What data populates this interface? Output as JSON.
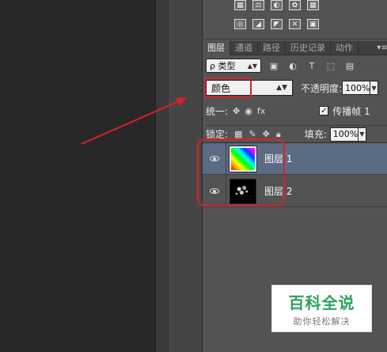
{
  "tabs": [
    {
      "label": "图层",
      "active": true
    },
    {
      "label": "通道",
      "active": false
    },
    {
      "label": "路径",
      "active": false
    },
    {
      "label": "历史记录",
      "active": false
    },
    {
      "label": "动作",
      "active": false
    }
  ],
  "filter": {
    "kind_label": "ρ 类型"
  },
  "blend": {
    "mode": "颜色",
    "opacity_label": "不透明度:",
    "opacity_value": "100%"
  },
  "unify": {
    "label": "统一:",
    "propagate_label": "传播帧 1"
  },
  "lock": {
    "label": "锁定:",
    "fill_label": "填充:",
    "fill_value": "100%"
  },
  "layers": [
    {
      "name": "图层 1",
      "selected": true
    },
    {
      "name": "图层 2",
      "selected": false
    }
  ],
  "watermark": {
    "title": "百科全说",
    "subtitle": "助你轻松解决"
  },
  "colors": {
    "panel": "#535353",
    "selected_layer": "#5c6b84",
    "highlight": "#d9222a",
    "brand_green": "#2aa35a"
  }
}
